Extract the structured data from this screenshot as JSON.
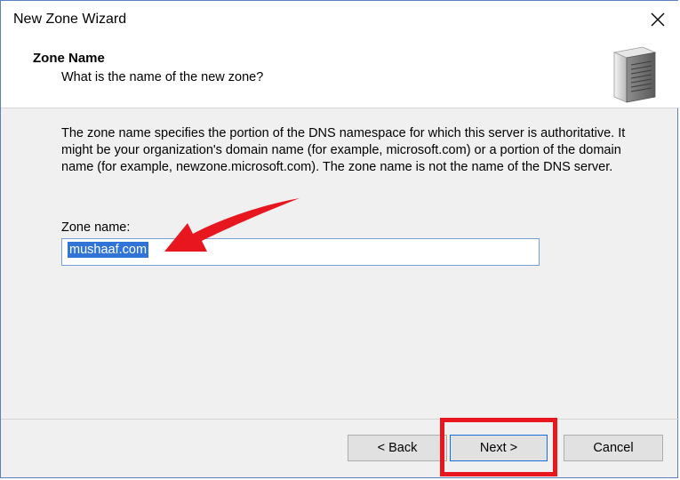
{
  "window": {
    "title": "New Zone Wizard"
  },
  "header": {
    "title": "Zone Name",
    "subtitle": "What is the name of the new zone?",
    "icon": "server-icon"
  },
  "main": {
    "description": "The zone name specifies the portion of the DNS namespace for which this server is authoritative. It might be your organization's domain name (for example,  microsoft.com) or a portion of the domain name (for example, newzone.microsoft.com). The zone name is not the name of the DNS server.",
    "zone_label": "Zone name:",
    "zone_value": "mushaaf.com"
  },
  "buttons": {
    "back": "< Back",
    "next": "Next >",
    "cancel": "Cancel"
  },
  "annotations": {
    "arrow_color": "#e8171f",
    "highlight_color": "#e8171f"
  }
}
